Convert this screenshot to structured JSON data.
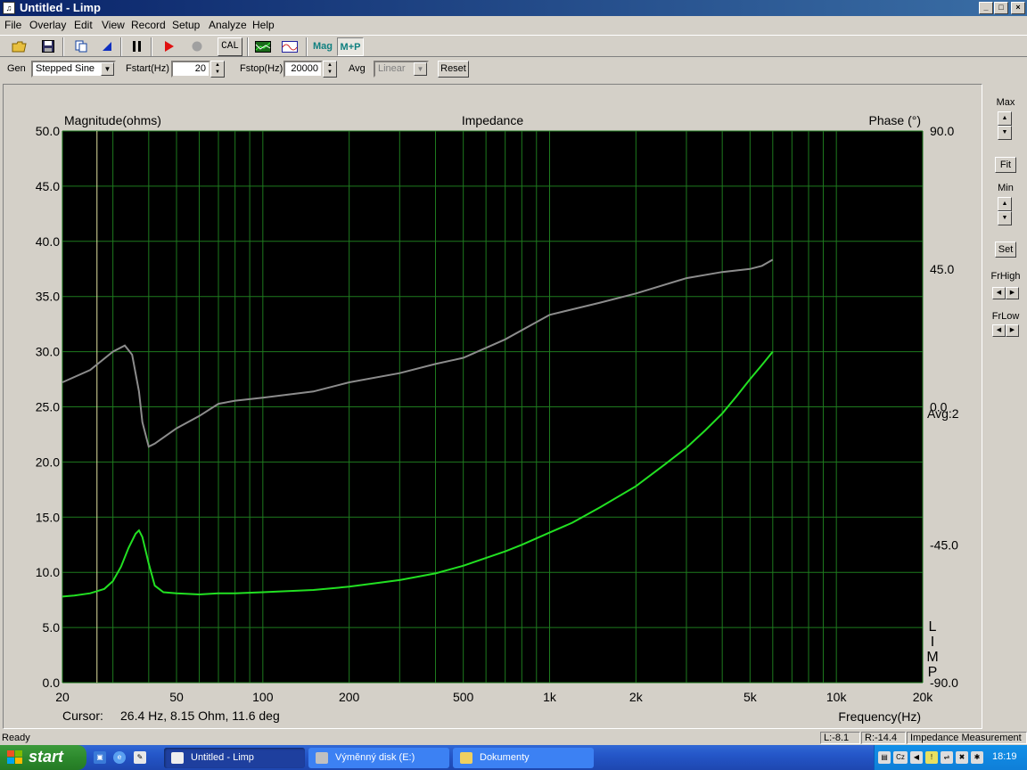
{
  "window": {
    "title": "Untitled - Limp",
    "minimize": "_",
    "maximize": "□",
    "close": "×"
  },
  "menu": [
    "File",
    "Overlay",
    "Edit",
    "View",
    "Record",
    "Setup",
    "Analyze",
    "Help"
  ],
  "toolbar": {
    "cal_label": "CAL",
    "mag_label": "Mag",
    "mp_label": "M+P"
  },
  "params": {
    "gen_label": "Gen",
    "gen_value": "Stepped Sine",
    "fstart_label": "Fstart(Hz)",
    "fstart_value": "20",
    "fstop_label": "Fstop(Hz)",
    "fstop_value": "20000",
    "avg_label": "Avg",
    "avg_value": "Linear",
    "reset_label": "Reset"
  },
  "plot": {
    "cursor_label": "Cursor:",
    "cursor_value": "26.4 Hz, 8.15 Ohm, 11.6 deg",
    "avg_text": "Avg:2",
    "watermark": [
      "L",
      "I",
      "M",
      "P"
    ]
  },
  "side": {
    "max_label": "Max",
    "fit_label": "Fit",
    "min_label": "Min",
    "set_label": "Set",
    "frhigh_label": "FrHigh",
    "frlow_label": "FrLow"
  },
  "status": {
    "ready": "Ready",
    "left": "L:-8.1",
    "right": "R:-14.4",
    "mode": "Impedance Measurement"
  },
  "taskbar": {
    "start_label": "start",
    "tasks": [
      "Untitled - Limp",
      "Výměnný disk (E:)",
      "Dokumenty"
    ],
    "clock": "18:19",
    "lang": "Cz"
  },
  "colors": {
    "plot_bg": "#000000",
    "grid": "#1e7a1e",
    "magnitude": "#22e022",
    "phase": "#8c8c8c",
    "cursor": "#e0e0a0"
  },
  "chart_data": {
    "type": "line",
    "title": "Impedance",
    "xlabel": "Frequency(Hz)",
    "ylabel": "Magnitude(ohms)",
    "y2label": "Phase (°)",
    "x_scale": "log",
    "xlim": [
      20,
      20000
    ],
    "ylim": [
      0,
      50
    ],
    "y2lim": [
      -90,
      90
    ],
    "grid": true,
    "x_ticks": [
      20,
      50,
      100,
      200,
      500,
      1000,
      2000,
      5000,
      10000,
      20000
    ],
    "x_tick_labels": [
      "20",
      "50",
      "100",
      "200",
      "500",
      "1k",
      "2k",
      "5k",
      "10k",
      "20k"
    ],
    "y_ticks": [
      0,
      5,
      10,
      15,
      20,
      25,
      30,
      35,
      40,
      45,
      50
    ],
    "y_tick_labels": [
      "0.0",
      "5.0",
      "10.0",
      "15.0",
      "20.0",
      "25.0",
      "30.0",
      "35.0",
      "40.0",
      "45.0",
      "50.0"
    ],
    "y2_ticks": [
      90,
      45,
      0,
      -45,
      -90
    ],
    "y2_tick_labels": [
      "90.0",
      "45.0",
      "0.0",
      "-45.0",
      "-90.0"
    ],
    "cursor_x": 26.4,
    "series": [
      {
        "name": "Magnitude",
        "x": [
          20,
          22,
          25,
          28,
          30,
          32,
          34,
          36,
          37,
          38,
          40,
          42,
          45,
          50,
          60,
          70,
          80,
          100,
          150,
          200,
          300,
          400,
          500,
          600,
          700,
          800,
          1000,
          1200,
          1500,
          2000,
          2500,
          3000,
          3500,
          4000,
          4500,
          5000,
          5500,
          6000
        ],
        "values": [
          7.8,
          7.9,
          8.1,
          8.5,
          9.2,
          10.5,
          12.2,
          13.5,
          13.8,
          13.2,
          10.8,
          8.8,
          8.2,
          8.1,
          8.0,
          8.1,
          8.1,
          8.2,
          8.4,
          8.7,
          9.3,
          9.9,
          10.6,
          11.3,
          11.9,
          12.5,
          13.6,
          14.5,
          15.9,
          17.8,
          19.7,
          21.3,
          22.9,
          24.4,
          26.0,
          27.5,
          28.8,
          30.0
        ]
      },
      {
        "name": "Phase",
        "x": [
          20,
          25,
          30,
          33,
          35,
          37,
          38,
          40,
          42,
          45,
          50,
          60,
          70,
          80,
          100,
          150,
          200,
          300,
          400,
          500,
          700,
          1000,
          1500,
          2000,
          3000,
          4000,
          5000,
          5500,
          6000
        ],
        "values": [
          8,
          12,
          18,
          20,
          17,
          5,
          -5,
          -13,
          -12,
          -10,
          -7,
          -3,
          1,
          2,
          3,
          5,
          8,
          11,
          14,
          16,
          22,
          30,
          34,
          37,
          42,
          44,
          45,
          46,
          48
        ]
      }
    ]
  }
}
